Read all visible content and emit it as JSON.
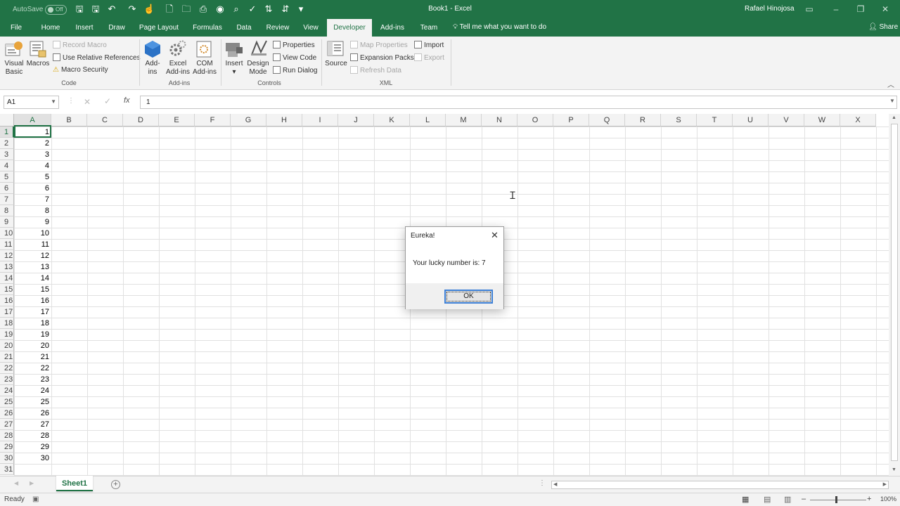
{
  "titlebar": {
    "autosave_label": "AutoSave",
    "autosave_state": "Off",
    "doc_title": "Book1 - Excel",
    "user": "Rafael Hinojosa"
  },
  "tabs": [
    "File",
    "Home",
    "Insert",
    "Draw",
    "Page Layout",
    "Formulas",
    "Data",
    "Review",
    "View",
    "Developer",
    "Add-ins",
    "Team"
  ],
  "active_tab": "Developer",
  "tell_me": "Tell me what you want to do",
  "share": "Share",
  "ribbon": {
    "code": {
      "visual_basic": "Visual Basic",
      "macros": "Macros",
      "record_macro": "Record Macro",
      "relative_refs": "Use Relative References",
      "macro_security": "Macro Security",
      "group": "Code"
    },
    "addins": {
      "addins": "Add-ins",
      "excel_addins": "Excel Add-ins",
      "com_addins": "COM Add-ins",
      "group": "Add-ins"
    },
    "controls": {
      "insert": "Insert",
      "design_mode": "Design Mode",
      "properties": "Properties",
      "view_code": "View Code",
      "run_dialog": "Run Dialog",
      "group": "Controls"
    },
    "xml": {
      "source": "Source",
      "map_properties": "Map Properties",
      "expansion_packs": "Expansion Packs",
      "refresh_data": "Refresh Data",
      "import": "Import",
      "export": "Export",
      "group": "XML"
    }
  },
  "formula_bar": {
    "name_box": "A1",
    "formula": "1",
    "fx": "fx"
  },
  "columns": [
    "A",
    "B",
    "C",
    "D",
    "E",
    "F",
    "G",
    "H",
    "I",
    "J",
    "K",
    "L",
    "M",
    "N",
    "O",
    "P",
    "Q",
    "R",
    "S",
    "T",
    "U",
    "V",
    "W",
    "X"
  ],
  "rows": [
    "1",
    "2",
    "3",
    "4",
    "5",
    "6",
    "7",
    "8",
    "9",
    "10",
    "11",
    "12",
    "13",
    "14",
    "15",
    "16",
    "17",
    "18",
    "19",
    "20",
    "21",
    "22",
    "23",
    "24",
    "25",
    "26",
    "27",
    "28",
    "29",
    "30",
    "31"
  ],
  "column_a_values": [
    "1",
    "2",
    "3",
    "4",
    "5",
    "6",
    "7",
    "8",
    "9",
    "10",
    "11",
    "12",
    "13",
    "14",
    "15",
    "16",
    "17",
    "18",
    "19",
    "20",
    "21",
    "22",
    "23",
    "24",
    "25",
    "26",
    "27",
    "28",
    "29",
    "30"
  ],
  "sheet_tab": "Sheet1",
  "status": {
    "ready": "Ready",
    "zoom": "100%"
  },
  "dialog": {
    "title": "Eureka!",
    "message": "Your lucky number is: 7",
    "ok": "OK"
  },
  "colors": {
    "excel_green": "#217346",
    "grid_line": "#e1e1e1",
    "ribbon_bg": "#f3f3f3"
  }
}
